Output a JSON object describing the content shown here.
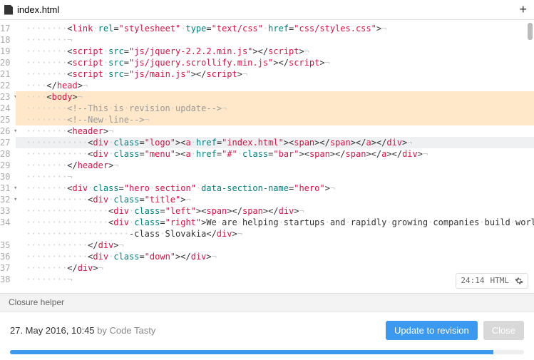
{
  "tab": {
    "filename": "index.html",
    "add_icon": "+"
  },
  "gutter": {
    "start": 17,
    "fold_lines": [
      23,
      26,
      31,
      32
    ]
  },
  "code": {
    "lines": [
      {
        "n": 17,
        "ind": 2,
        "segs": [
          {
            "c": "t-punc",
            "t": "<"
          },
          {
            "c": "t-tag",
            "t": "link"
          },
          {
            "c": "ws",
            "t": "·"
          },
          {
            "c": "t-attr",
            "t": "rel"
          },
          {
            "c": "t-punc",
            "t": "="
          },
          {
            "c": "t-str",
            "t": "\"stylesheet\""
          },
          {
            "c": "ws",
            "t": "·"
          },
          {
            "c": "t-attr",
            "t": "type"
          },
          {
            "c": "t-punc",
            "t": "="
          },
          {
            "c": "t-str",
            "t": "\"text/css\""
          },
          {
            "c": "ws",
            "t": "·"
          },
          {
            "c": "t-attr",
            "t": "href"
          },
          {
            "c": "t-punc",
            "t": "="
          },
          {
            "c": "t-str",
            "t": "\"css/styles.css\""
          },
          {
            "c": "t-punc",
            "t": ">"
          },
          {
            "c": "ws",
            "t": "¬"
          }
        ]
      },
      {
        "n": 18,
        "ind": 2,
        "segs": [
          {
            "c": "ws",
            "t": "¬"
          }
        ]
      },
      {
        "n": 19,
        "ind": 2,
        "segs": [
          {
            "c": "t-punc",
            "t": "<"
          },
          {
            "c": "t-tag",
            "t": "script"
          },
          {
            "c": "ws",
            "t": "·"
          },
          {
            "c": "t-attr",
            "t": "src"
          },
          {
            "c": "t-punc",
            "t": "="
          },
          {
            "c": "t-str",
            "t": "\"js/jquery-2.2.2.min.js\""
          },
          {
            "c": "t-punc",
            "t": "></"
          },
          {
            "c": "t-tag",
            "t": "script"
          },
          {
            "c": "t-punc",
            "t": ">"
          },
          {
            "c": "ws",
            "t": "¬"
          }
        ]
      },
      {
        "n": 20,
        "ind": 2,
        "segs": [
          {
            "c": "t-punc",
            "t": "<"
          },
          {
            "c": "t-tag",
            "t": "script"
          },
          {
            "c": "ws",
            "t": "·"
          },
          {
            "c": "t-attr",
            "t": "src"
          },
          {
            "c": "t-punc",
            "t": "="
          },
          {
            "c": "t-str",
            "t": "\"js/jquery.scrollify.min.js\""
          },
          {
            "c": "t-punc",
            "t": "></"
          },
          {
            "c": "t-tag",
            "t": "script"
          },
          {
            "c": "t-punc",
            "t": ">"
          },
          {
            "c": "ws",
            "t": "¬"
          }
        ]
      },
      {
        "n": 21,
        "ind": 2,
        "segs": [
          {
            "c": "t-punc",
            "t": "<"
          },
          {
            "c": "t-tag",
            "t": "script"
          },
          {
            "c": "ws",
            "t": "·"
          },
          {
            "c": "t-attr",
            "t": "src"
          },
          {
            "c": "t-punc",
            "t": "="
          },
          {
            "c": "t-str",
            "t": "\"js/main.js\""
          },
          {
            "c": "t-punc",
            "t": "></"
          },
          {
            "c": "t-tag",
            "t": "script"
          },
          {
            "c": "t-punc",
            "t": ">"
          },
          {
            "c": "ws",
            "t": "¬"
          }
        ]
      },
      {
        "n": 22,
        "ind": 1,
        "segs": [
          {
            "c": "t-punc",
            "t": "</"
          },
          {
            "c": "t-tag",
            "t": "head"
          },
          {
            "c": "t-punc",
            "t": ">"
          },
          {
            "c": "ws",
            "t": "¬"
          }
        ]
      },
      {
        "n": 23,
        "ind": 1,
        "hl": "mod",
        "segs": [
          {
            "c": "t-punc",
            "t": "<"
          },
          {
            "c": "t-tag",
            "t": "body"
          },
          {
            "c": "t-punc",
            "t": ">"
          },
          {
            "c": "ws",
            "t": "¬"
          }
        ]
      },
      {
        "n": 24,
        "ind": 2,
        "hl": "mod",
        "segs": [
          {
            "c": "t-cmt",
            "t": "<!--This"
          },
          {
            "c": "ws",
            "t": "·"
          },
          {
            "c": "t-cmt",
            "t": "is"
          },
          {
            "c": "ws",
            "t": "·"
          },
          {
            "c": "t-cmt",
            "t": "revision"
          },
          {
            "c": "ws",
            "t": "·"
          },
          {
            "c": "t-cmt",
            "t": "update-->"
          },
          {
            "c": "ws",
            "t": "¬"
          }
        ]
      },
      {
        "n": 25,
        "ind": 2,
        "hl": "mod",
        "segs": [
          {
            "c": "t-cmt",
            "t": "<!--New"
          },
          {
            "c": "ws",
            "t": "·"
          },
          {
            "c": "t-cmt",
            "t": "line-->"
          },
          {
            "c": "ws",
            "t": "¬"
          }
        ]
      },
      {
        "n": 26,
        "ind": 2,
        "segs": [
          {
            "c": "t-punc",
            "t": "<"
          },
          {
            "c": "t-tag",
            "t": "header"
          },
          {
            "c": "t-punc",
            "t": ">"
          },
          {
            "c": "ws",
            "t": "¬"
          }
        ]
      },
      {
        "n": 27,
        "ind": 3,
        "hl": "cursor",
        "segs": [
          {
            "c": "t-punc",
            "t": "<"
          },
          {
            "c": "t-tag",
            "t": "div"
          },
          {
            "c": "ws",
            "t": "·"
          },
          {
            "c": "t-attr",
            "t": "class"
          },
          {
            "c": "t-punc",
            "t": "="
          },
          {
            "c": "t-str",
            "t": "\"logo\""
          },
          {
            "c": "t-punc",
            "t": "><"
          },
          {
            "c": "t-tag",
            "t": "a"
          },
          {
            "c": "ws",
            "t": "·"
          },
          {
            "c": "t-attr",
            "t": "href"
          },
          {
            "c": "t-punc",
            "t": "="
          },
          {
            "c": "t-str",
            "t": "\"index.html\""
          },
          {
            "c": "t-punc",
            "t": "><"
          },
          {
            "c": "t-tag",
            "t": "span"
          },
          {
            "c": "t-punc",
            "t": "></"
          },
          {
            "c": "t-tag",
            "t": "span"
          },
          {
            "c": "t-punc",
            "t": "></"
          },
          {
            "c": "t-tag",
            "t": "a"
          },
          {
            "c": "t-punc",
            "t": "></"
          },
          {
            "c": "t-tag",
            "t": "div"
          },
          {
            "c": "t-punc",
            "t": ">"
          },
          {
            "c": "ws",
            "t": "¬"
          }
        ]
      },
      {
        "n": 28,
        "ind": 3,
        "segs": [
          {
            "c": "t-punc",
            "t": "<"
          },
          {
            "c": "t-tag",
            "t": "div"
          },
          {
            "c": "ws",
            "t": "·"
          },
          {
            "c": "t-attr",
            "t": "class"
          },
          {
            "c": "t-punc",
            "t": "="
          },
          {
            "c": "t-str",
            "t": "\"menu\""
          },
          {
            "c": "t-punc",
            "t": "><"
          },
          {
            "c": "t-tag",
            "t": "a"
          },
          {
            "c": "ws",
            "t": "·"
          },
          {
            "c": "t-attr",
            "t": "href"
          },
          {
            "c": "t-punc",
            "t": "="
          },
          {
            "c": "t-str",
            "t": "\"#\""
          },
          {
            "c": "ws",
            "t": "·"
          },
          {
            "c": "t-attr",
            "t": "class"
          },
          {
            "c": "t-punc",
            "t": "="
          },
          {
            "c": "t-str",
            "t": "\"bar\""
          },
          {
            "c": "t-punc",
            "t": "><"
          },
          {
            "c": "t-tag",
            "t": "span"
          },
          {
            "c": "t-punc",
            "t": "></"
          },
          {
            "c": "t-tag",
            "t": "span"
          },
          {
            "c": "t-punc",
            "t": "></"
          },
          {
            "c": "t-tag",
            "t": "a"
          },
          {
            "c": "t-punc",
            "t": "></"
          },
          {
            "c": "t-tag",
            "t": "div"
          },
          {
            "c": "t-punc",
            "t": ">"
          },
          {
            "c": "ws",
            "t": "¬"
          }
        ]
      },
      {
        "n": 29,
        "ind": 2,
        "segs": [
          {
            "c": "t-punc",
            "t": "</"
          },
          {
            "c": "t-tag",
            "t": "header"
          },
          {
            "c": "t-punc",
            "t": ">"
          },
          {
            "c": "ws",
            "t": "¬"
          }
        ]
      },
      {
        "n": 30,
        "ind": 2,
        "segs": [
          {
            "c": "ws",
            "t": "¬"
          }
        ]
      },
      {
        "n": 31,
        "ind": 2,
        "segs": [
          {
            "c": "t-punc",
            "t": "<"
          },
          {
            "c": "t-tag",
            "t": "div"
          },
          {
            "c": "ws",
            "t": "·"
          },
          {
            "c": "t-attr",
            "t": "class"
          },
          {
            "c": "t-punc",
            "t": "="
          },
          {
            "c": "t-str",
            "t": "\"hero"
          },
          {
            "c": "ws",
            "t": "·"
          },
          {
            "c": "t-str",
            "t": "section\""
          },
          {
            "c": "ws",
            "t": "·"
          },
          {
            "c": "t-attr",
            "t": "data-section-name"
          },
          {
            "c": "t-punc",
            "t": "="
          },
          {
            "c": "t-str",
            "t": "\"hero\""
          },
          {
            "c": "t-punc",
            "t": ">"
          },
          {
            "c": "ws",
            "t": "¬"
          }
        ]
      },
      {
        "n": 32,
        "ind": 3,
        "segs": [
          {
            "c": "t-punc",
            "t": "<"
          },
          {
            "c": "t-tag",
            "t": "div"
          },
          {
            "c": "ws",
            "t": "·"
          },
          {
            "c": "t-attr",
            "t": "class"
          },
          {
            "c": "t-punc",
            "t": "="
          },
          {
            "c": "t-str",
            "t": "\"title\""
          },
          {
            "c": "t-punc",
            "t": ">"
          },
          {
            "c": "ws",
            "t": "¬"
          }
        ]
      },
      {
        "n": 33,
        "ind": 4,
        "segs": [
          {
            "c": "t-punc",
            "t": "<"
          },
          {
            "c": "t-tag",
            "t": "div"
          },
          {
            "c": "ws",
            "t": "·"
          },
          {
            "c": "t-attr",
            "t": "class"
          },
          {
            "c": "t-punc",
            "t": "="
          },
          {
            "c": "t-str",
            "t": "\"left\""
          },
          {
            "c": "t-punc",
            "t": "><"
          },
          {
            "c": "t-tag",
            "t": "span"
          },
          {
            "c": "t-punc",
            "t": "></"
          },
          {
            "c": "t-tag",
            "t": "span"
          },
          {
            "c": "t-punc",
            "t": "></"
          },
          {
            "c": "t-tag",
            "t": "div"
          },
          {
            "c": "t-punc",
            "t": ">"
          },
          {
            "c": "ws",
            "t": "¬"
          }
        ]
      },
      {
        "n": 34,
        "ind": 4,
        "segs": [
          {
            "c": "t-punc",
            "t": "<"
          },
          {
            "c": "t-tag",
            "t": "div"
          },
          {
            "c": "ws",
            "t": "·"
          },
          {
            "c": "t-attr",
            "t": "class"
          },
          {
            "c": "t-punc",
            "t": "="
          },
          {
            "c": "t-str",
            "t": "\"right\""
          },
          {
            "c": "t-punc",
            "t": ">"
          },
          {
            "c": "t-txt",
            "t": "We"
          },
          {
            "c": "ws",
            "t": "·"
          },
          {
            "c": "t-txt",
            "t": "are"
          },
          {
            "c": "ws",
            "t": "·"
          },
          {
            "c": "t-txt",
            "t": "helping"
          },
          {
            "c": "ws",
            "t": "·"
          },
          {
            "c": "t-txt",
            "t": "startups"
          },
          {
            "c": "ws",
            "t": "·"
          },
          {
            "c": "t-txt",
            "t": "and"
          },
          {
            "c": "ws",
            "t": "·"
          },
          {
            "c": "t-txt",
            "t": "rapidly"
          },
          {
            "c": "ws",
            "t": "·"
          },
          {
            "c": "t-txt",
            "t": "growing"
          },
          {
            "c": "ws",
            "t": "·"
          },
          {
            "c": "t-txt",
            "t": "companies"
          },
          {
            "c": "ws",
            "t": "·"
          },
          {
            "c": "t-txt",
            "t": "build"
          },
          {
            "c": "ws",
            "t": "·"
          },
          {
            "c": "t-txt",
            "t": "world"
          }
        ]
      },
      {
        "n": 0,
        "cont": true,
        "ind": 5,
        "segs": [
          {
            "c": "t-txt",
            "t": "-class"
          },
          {
            "c": "ws",
            "t": "·"
          },
          {
            "c": "t-txt",
            "t": "Slovakia"
          },
          {
            "c": "t-punc",
            "t": "</"
          },
          {
            "c": "t-tag",
            "t": "div"
          },
          {
            "c": "t-punc",
            "t": ">"
          },
          {
            "c": "ws",
            "t": "¬"
          }
        ]
      },
      {
        "n": 35,
        "ind": 3,
        "segs": [
          {
            "c": "t-punc",
            "t": "</"
          },
          {
            "c": "t-tag",
            "t": "div"
          },
          {
            "c": "t-punc",
            "t": ">"
          },
          {
            "c": "ws",
            "t": "¬"
          }
        ]
      },
      {
        "n": 36,
        "ind": 3,
        "segs": [
          {
            "c": "t-punc",
            "t": "<"
          },
          {
            "c": "t-tag",
            "t": "div"
          },
          {
            "c": "ws",
            "t": "·"
          },
          {
            "c": "t-attr",
            "t": "class"
          },
          {
            "c": "t-punc",
            "t": "="
          },
          {
            "c": "t-str",
            "t": "\"down\""
          },
          {
            "c": "t-punc",
            "t": "></"
          },
          {
            "c": "t-tag",
            "t": "div"
          },
          {
            "c": "t-punc",
            "t": ">"
          },
          {
            "c": "ws",
            "t": "¬"
          }
        ]
      },
      {
        "n": 37,
        "ind": 2,
        "segs": [
          {
            "c": "t-punc",
            "t": "</"
          },
          {
            "c": "t-tag",
            "t": "div"
          },
          {
            "c": "t-punc",
            "t": ">"
          },
          {
            "c": "ws",
            "t": "¬"
          }
        ]
      },
      {
        "n": 38,
        "ind": 2,
        "segs": [
          {
            "c": "ws",
            "t": "¬"
          }
        ]
      }
    ]
  },
  "status": {
    "pos": "24:14",
    "lang": "HTML"
  },
  "closure": {
    "label": "Closure helper"
  },
  "footer": {
    "date": "27. May 2016, 10:45",
    "by_word": "by",
    "author": "Code Tasty",
    "update_btn": "Update to revision",
    "close_btn": "Close"
  }
}
